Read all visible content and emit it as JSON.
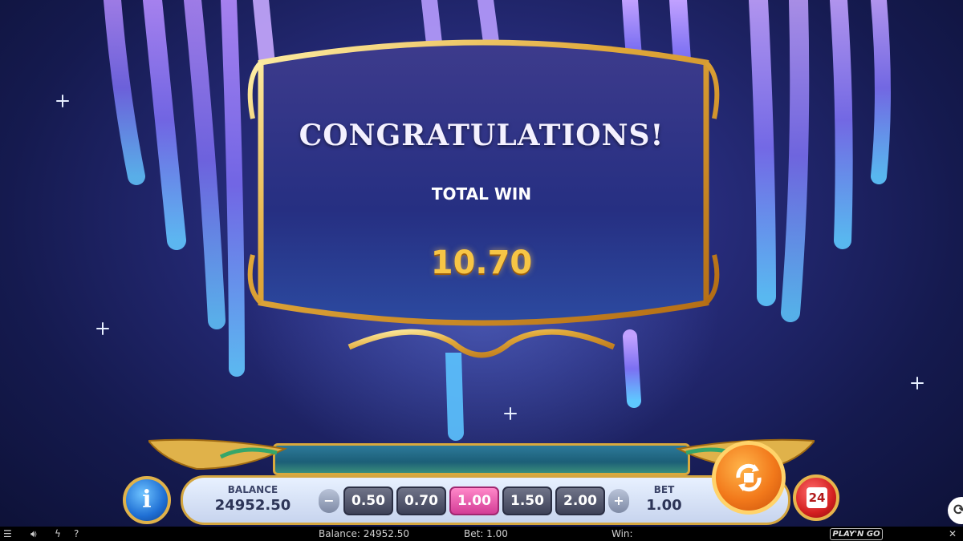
{
  "dialog": {
    "title": "CONGRATULATIONS!",
    "total_win_label": "TOTAL WIN",
    "total_win_value": "10.70"
  },
  "panel": {
    "balance_label": "BALANCE",
    "balance_value": "24952.50",
    "bet_label": "BET",
    "bet_value": "1.00",
    "bet_options": [
      "0.50",
      "0.70",
      "1.00",
      "1.50",
      "2.00"
    ],
    "selected_bet": "1.00",
    "info_label": "i",
    "autoplay_count": "24",
    "decrease_label": "−",
    "increase_label": "+"
  },
  "statusbar": {
    "balance_text": "Balance: 24952.50",
    "bet_text": "Bet: 1.00",
    "win_text": "Win:",
    "brand": "PLAY'N GO",
    "close": "✕",
    "help": "?",
    "menu_icon": "menu-icon",
    "sound_icon": "speaker-icon",
    "turbo_icon": "lightning-icon"
  },
  "colors": {
    "accent_gold": "#d9a93d",
    "win_gold": "#f7c545",
    "selected_bet": "#e04da0",
    "spin_orange": "#f2791b"
  }
}
